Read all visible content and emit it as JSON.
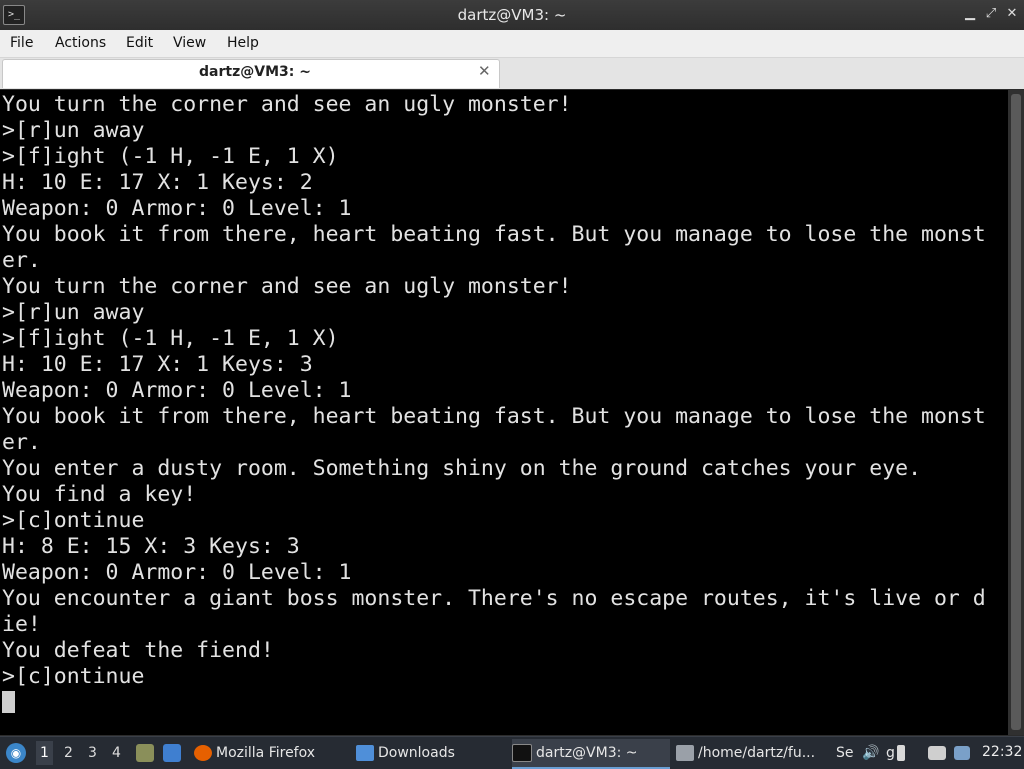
{
  "window": {
    "title": "dartz@VM3: ~",
    "terminal_icon_glyph": ">_",
    "minimize_glyph": "▁",
    "maximize_glyph": "⤢",
    "close_glyph": "✕"
  },
  "menu": {
    "items": [
      "File",
      "Actions",
      "Edit",
      "View",
      "Help"
    ]
  },
  "tabs": [
    {
      "label": "dartz@VM3: ~",
      "close_glyph": "✕"
    }
  ],
  "terminal": {
    "background": "#000000",
    "foreground": "#e2e2e2",
    "lines": [
      "You turn the corner and see an ugly monster!",
      ">[r]un away",
      ">[f]ight (-1 H, -1 E, 1 X)",
      "H: 10 E: 17 X: 1 Keys: 2",
      "Weapon: 0 Armor: 0 Level: 1",
      "You book it from there, heart beating fast. But you manage to lose the monst",
      "er.",
      "You turn the corner and see an ugly monster!",
      ">[r]un away",
      ">[f]ight (-1 H, -1 E, 1 X)",
      "H: 10 E: 17 X: 1 Keys: 3",
      "Weapon: 0 Armor: 0 Level: 1",
      "You book it from there, heart beating fast. But you manage to lose the monst",
      "er.",
      "You enter a dusty room. Something shiny on the ground catches your eye.",
      "You find a key!",
      ">[c]ontinue",
      "H: 8 E: 15 X: 3 Keys: 3",
      "Weapon: 0 Armor: 0 Level: 1",
      "You encounter a giant boss monster. There's no escape routes, it's live or d",
      "ie!",
      "You defeat the fiend!",
      ">[c]ontinue"
    ]
  },
  "taskbar": {
    "start_icon": "start-menu-icon",
    "workspaces": [
      "1",
      "2",
      "3",
      "4"
    ],
    "active_workspace": "1",
    "tasks": [
      {
        "label": "Mozilla Firefox",
        "icon": "firefox-icon",
        "icon_color": "#e66000"
      },
      {
        "label": "Downloads",
        "icon": "folder-icon",
        "icon_color": "#4f8fd9"
      },
      {
        "label": "dartz@VM3: ~",
        "icon": "terminal-icon",
        "icon_color": "#333333"
      },
      {
        "label": "/home/dartz/fu...",
        "icon": "text-editor-icon",
        "icon_color": "#9aa0a8"
      },
      {
        "label": "Se",
        "icon": "settings-icon",
        "icon_color": "#9aa0a8"
      },
      {
        "label": "g",
        "icon": "app-icon",
        "icon_color": "#9aa0a8"
      }
    ],
    "clock": "22:32",
    "tray_glyph_volume": "🔊"
  },
  "colors": {
    "accent": "#6a9fd4",
    "taskbar_bg": "#262b33",
    "title_bg": "#333333"
  }
}
